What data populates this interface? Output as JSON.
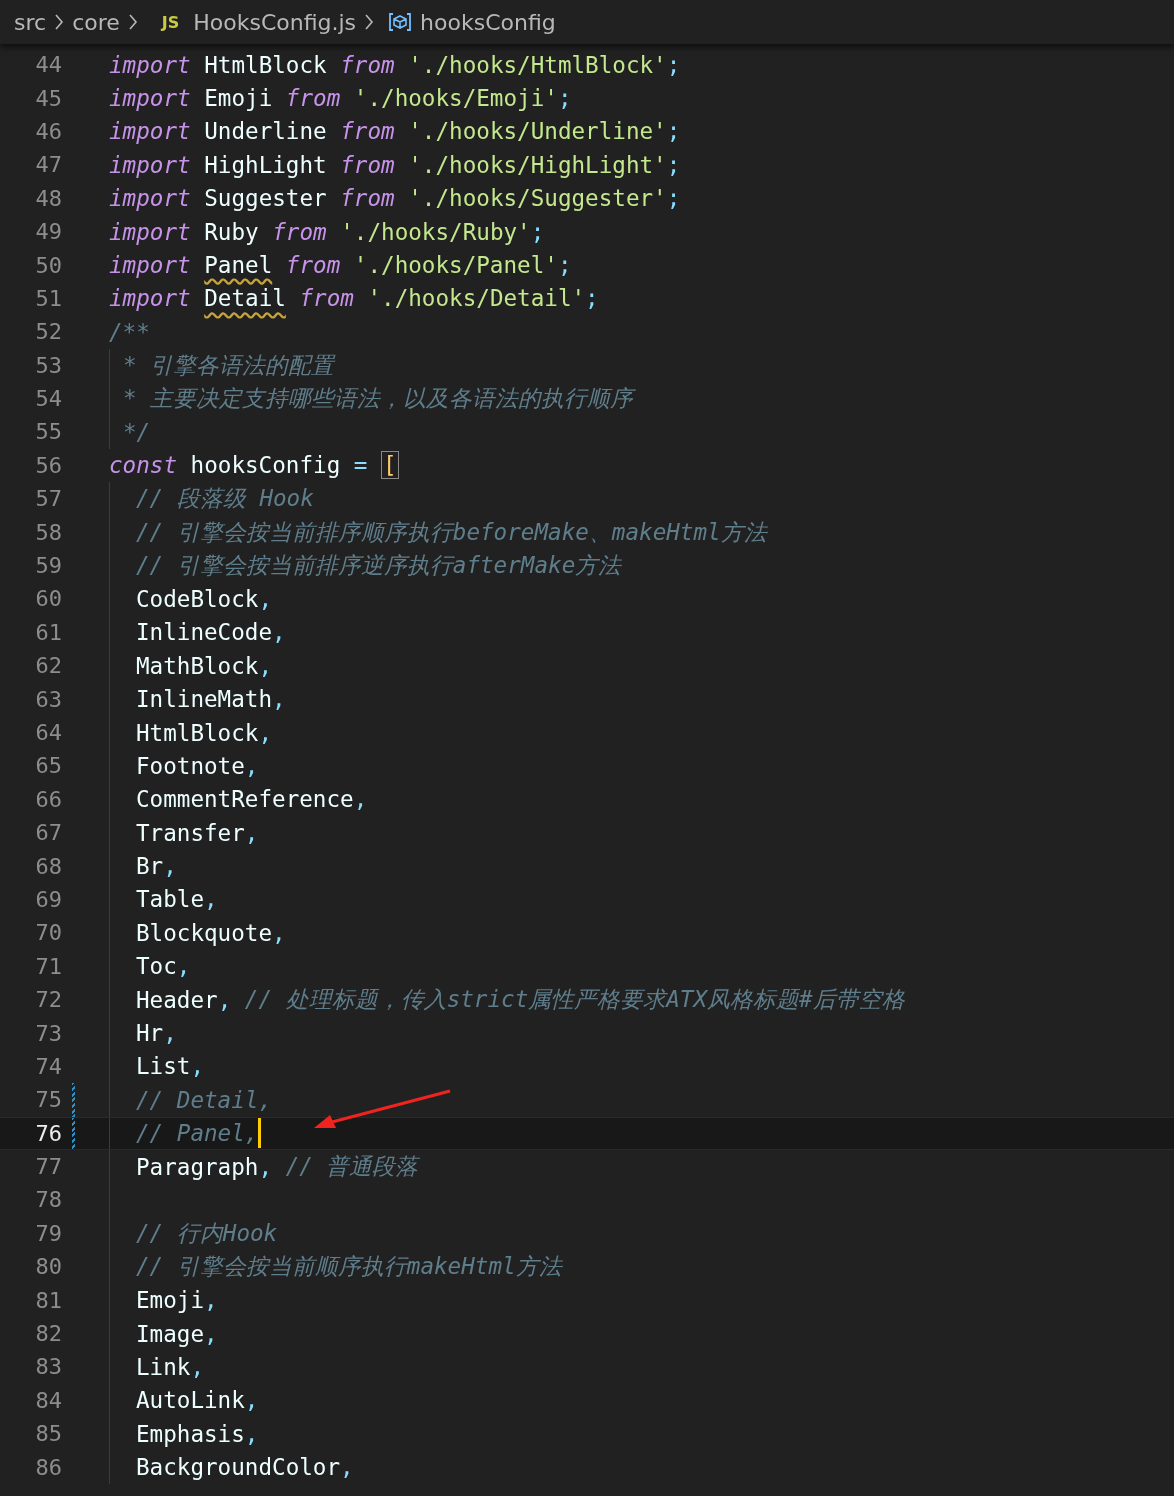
{
  "breadcrumbs": [
    {
      "kind": "folder",
      "label": "src"
    },
    {
      "kind": "folder",
      "label": "core"
    },
    {
      "kind": "file",
      "badge": "JS",
      "label": "HooksConfig.js"
    },
    {
      "kind": "symbol",
      "label": "hooksConfig"
    }
  ],
  "lines": [
    {
      "n": "44",
      "kind": "top",
      "tokens": [
        {
          "t": "import",
          "kind": "kw"
        },
        {
          "t": "HtmlBlock",
          "kind": "id"
        },
        {
          "t": "from",
          "kind": "kw"
        },
        {
          "t": "'./hooks/HtmlBlock'",
          "kind": "str"
        },
        {
          "t": ";",
          "kind": "p"
        }
      ]
    },
    {
      "n": "45",
      "kind": "top",
      "tokens": [
        {
          "t": "import",
          "kind": "kw"
        },
        {
          "t": "Emoji",
          "kind": "id"
        },
        {
          "t": "from",
          "kind": "kw"
        },
        {
          "t": "'./hooks/Emoji'",
          "kind": "str"
        },
        {
          "t": ";",
          "kind": "p"
        }
      ]
    },
    {
      "n": "46",
      "kind": "top",
      "tokens": [
        {
          "t": "import",
          "kind": "kw"
        },
        {
          "t": "Underline",
          "kind": "id"
        },
        {
          "t": "from",
          "kind": "kw"
        },
        {
          "t": "'./hooks/Underline'",
          "kind": "str"
        },
        {
          "t": ";",
          "kind": "p"
        }
      ]
    },
    {
      "n": "47",
      "kind": "top",
      "tokens": [
        {
          "t": "import",
          "kind": "kw"
        },
        {
          "t": "HighLight",
          "kind": "id"
        },
        {
          "t": "from",
          "kind": "kw"
        },
        {
          "t": "'./hooks/HighLight'",
          "kind": "str"
        },
        {
          "t": ";",
          "kind": "p"
        }
      ]
    },
    {
      "n": "48",
      "kind": "top",
      "tokens": [
        {
          "t": "import",
          "kind": "kw"
        },
        {
          "t": "Suggester",
          "kind": "id"
        },
        {
          "t": "from",
          "kind": "kw"
        },
        {
          "t": "'./hooks/Suggester'",
          "kind": "str"
        },
        {
          "t": ";",
          "kind": "p"
        }
      ]
    },
    {
      "n": "49",
      "kind": "top",
      "tokens": [
        {
          "t": "import",
          "kind": "kw"
        },
        {
          "t": "Ruby",
          "kind": "id"
        },
        {
          "t": "from",
          "kind": "kw"
        },
        {
          "t": "'./hooks/Ruby'",
          "kind": "str"
        },
        {
          "t": ";",
          "kind": "p"
        }
      ]
    },
    {
      "n": "50",
      "kind": "top",
      "tokens": [
        {
          "t": "import",
          "kind": "kw"
        },
        {
          "t": "Panel",
          "kind": "id",
          "warning": true
        },
        {
          "t": "from",
          "kind": "kw"
        },
        {
          "t": "'./hooks/Panel'",
          "kind": "str"
        },
        {
          "t": ";",
          "kind": "p"
        }
      ]
    },
    {
      "n": "51",
      "kind": "top",
      "tokens": [
        {
          "t": "import",
          "kind": "kw"
        },
        {
          "t": "Detail",
          "kind": "id",
          "warning": true
        },
        {
          "t": "from",
          "kind": "kw"
        },
        {
          "t": "'./hooks/Detail'",
          "kind": "str"
        },
        {
          "t": ";",
          "kind": "p"
        }
      ]
    },
    {
      "n": "52",
      "kind": "top",
      "tokens": [
        {
          "t": "/**",
          "kind": "cm"
        }
      ]
    },
    {
      "n": "53",
      "kind": "doc",
      "tokens": [
        {
          "t": "* 引擎各语法的配置",
          "kind": "cm"
        }
      ]
    },
    {
      "n": "54",
      "kind": "doc",
      "tokens": [
        {
          "t": "* 主要决定支持哪些语法，以及各语法的执行顺序",
          "kind": "cm"
        }
      ]
    },
    {
      "n": "55",
      "kind": "doc",
      "tokens": [
        {
          "t": "*/",
          "kind": "cm"
        }
      ]
    },
    {
      "n": "56",
      "kind": "top",
      "tokens": [
        {
          "t": "const",
          "kind": "kw"
        },
        {
          "t": "hooksConfig",
          "kind": "id"
        },
        {
          "t": "=",
          "kind": "op"
        },
        {
          "t": "[",
          "kind": "br",
          "match": true
        }
      ]
    },
    {
      "n": "57",
      "kind": "block",
      "tokens": [
        {
          "t": "// 段落级 Hook",
          "kind": "cm"
        }
      ]
    },
    {
      "n": "58",
      "kind": "block",
      "tokens": [
        {
          "t": "// 引擎会按当前排序顺序执行beforeMake、makeHtml方法",
          "kind": "cm"
        }
      ]
    },
    {
      "n": "59",
      "kind": "block",
      "tokens": [
        {
          "t": "// 引擎会按当前排序逆序执行afterMake方法",
          "kind": "cm"
        }
      ]
    },
    {
      "n": "60",
      "kind": "block",
      "tokens": [
        {
          "t": "CodeBlock",
          "kind": "id"
        },
        {
          "t": ",",
          "kind": "p"
        }
      ]
    },
    {
      "n": "61",
      "kind": "block",
      "tokens": [
        {
          "t": "InlineCode",
          "kind": "id"
        },
        {
          "t": ",",
          "kind": "p"
        }
      ]
    },
    {
      "n": "62",
      "kind": "block",
      "tokens": [
        {
          "t": "MathBlock",
          "kind": "id"
        },
        {
          "t": ",",
          "kind": "p"
        }
      ]
    },
    {
      "n": "63",
      "kind": "block",
      "tokens": [
        {
          "t": "InlineMath",
          "kind": "id"
        },
        {
          "t": ",",
          "kind": "p"
        }
      ]
    },
    {
      "n": "64",
      "kind": "block",
      "tokens": [
        {
          "t": "HtmlBlock",
          "kind": "id"
        },
        {
          "t": ",",
          "kind": "p"
        }
      ]
    },
    {
      "n": "65",
      "kind": "block",
      "tokens": [
        {
          "t": "Footnote",
          "kind": "id"
        },
        {
          "t": ",",
          "kind": "p"
        }
      ]
    },
    {
      "n": "66",
      "kind": "block",
      "tokens": [
        {
          "t": "CommentReference",
          "kind": "id"
        },
        {
          "t": ",",
          "kind": "p"
        }
      ]
    },
    {
      "n": "67",
      "kind": "block",
      "tokens": [
        {
          "t": "Transfer",
          "kind": "id"
        },
        {
          "t": ",",
          "kind": "p"
        }
      ]
    },
    {
      "n": "68",
      "kind": "block",
      "tokens": [
        {
          "t": "Br",
          "kind": "id"
        },
        {
          "t": ",",
          "kind": "p"
        }
      ]
    },
    {
      "n": "69",
      "kind": "block",
      "tokens": [
        {
          "t": "Table",
          "kind": "id"
        },
        {
          "t": ",",
          "kind": "p"
        }
      ]
    },
    {
      "n": "70",
      "kind": "block",
      "tokens": [
        {
          "t": "Blockquote",
          "kind": "id"
        },
        {
          "t": ",",
          "kind": "p"
        }
      ]
    },
    {
      "n": "71",
      "kind": "block",
      "tokens": [
        {
          "t": "Toc",
          "kind": "id"
        },
        {
          "t": ",",
          "kind": "p"
        }
      ]
    },
    {
      "n": "72",
      "kind": "block",
      "tokens": [
        {
          "t": "Header",
          "kind": "id"
        },
        {
          "t": ",",
          "kind": "p"
        },
        {
          "t": "// 处理标题，传入strict属性严格要求ATX风格标题#后带空格",
          "kind": "cm"
        }
      ]
    },
    {
      "n": "73",
      "kind": "block",
      "tokens": [
        {
          "t": "Hr",
          "kind": "id"
        },
        {
          "t": ",",
          "kind": "p"
        }
      ]
    },
    {
      "n": "74",
      "kind": "block",
      "tokens": [
        {
          "t": "List",
          "kind": "id"
        },
        {
          "t": ",",
          "kind": "p"
        }
      ]
    },
    {
      "n": "75",
      "kind": "block",
      "modified": true,
      "tokens": [
        {
          "t": "// Detail,",
          "kind": "cm"
        }
      ]
    },
    {
      "n": "76",
      "kind": "block",
      "modified": true,
      "current": true,
      "tokens": [
        {
          "t": "// Panel,",
          "kind": "cm"
        }
      ]
    },
    {
      "n": "77",
      "kind": "block",
      "tokens": [
        {
          "t": "Paragraph",
          "kind": "id"
        },
        {
          "t": ",",
          "kind": "p"
        },
        {
          "t": "// 普通段落",
          "kind": "cm"
        }
      ]
    },
    {
      "n": "78",
      "kind": "block"
    },
    {
      "n": "79",
      "kind": "block",
      "tokens": [
        {
          "t": "// 行内Hook",
          "kind": "cm"
        }
      ]
    },
    {
      "n": "80",
      "kind": "block",
      "tokens": [
        {
          "t": "// 引擎会按当前顺序执行makeHtml方法",
          "kind": "cm"
        }
      ]
    },
    {
      "n": "81",
      "kind": "block",
      "tokens": [
        {
          "t": "Emoji",
          "kind": "id"
        },
        {
          "t": ",",
          "kind": "p"
        }
      ]
    },
    {
      "n": "82",
      "kind": "block",
      "tokens": [
        {
          "t": "Image",
          "kind": "id"
        },
        {
          "t": ",",
          "kind": "p"
        }
      ]
    },
    {
      "n": "83",
      "kind": "block",
      "tokens": [
        {
          "t": "Link",
          "kind": "id"
        },
        {
          "t": ",",
          "kind": "p"
        }
      ]
    },
    {
      "n": "84",
      "kind": "block",
      "tokens": [
        {
          "t": "AutoLink",
          "kind": "id"
        },
        {
          "t": ",",
          "kind": "p"
        }
      ]
    },
    {
      "n": "85",
      "kind": "block",
      "tokens": [
        {
          "t": "Emphasis",
          "kind": "id"
        },
        {
          "t": ",",
          "kind": "p"
        }
      ]
    },
    {
      "n": "86",
      "kind": "block",
      "tokens": [
        {
          "t": "BackgroundColor",
          "kind": "id"
        },
        {
          "t": ",",
          "kind": "p"
        }
      ]
    }
  ]
}
